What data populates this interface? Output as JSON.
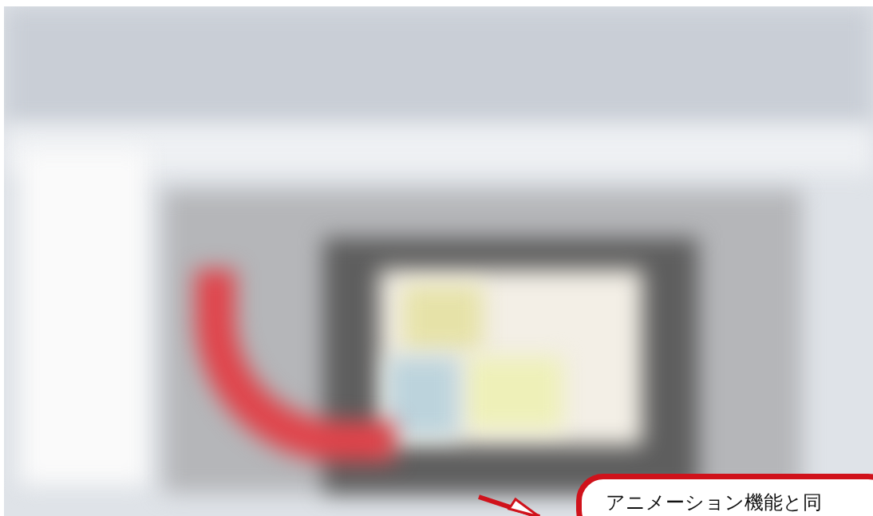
{
  "callout": {
    "text": "アニメーション機能と同"
  }
}
